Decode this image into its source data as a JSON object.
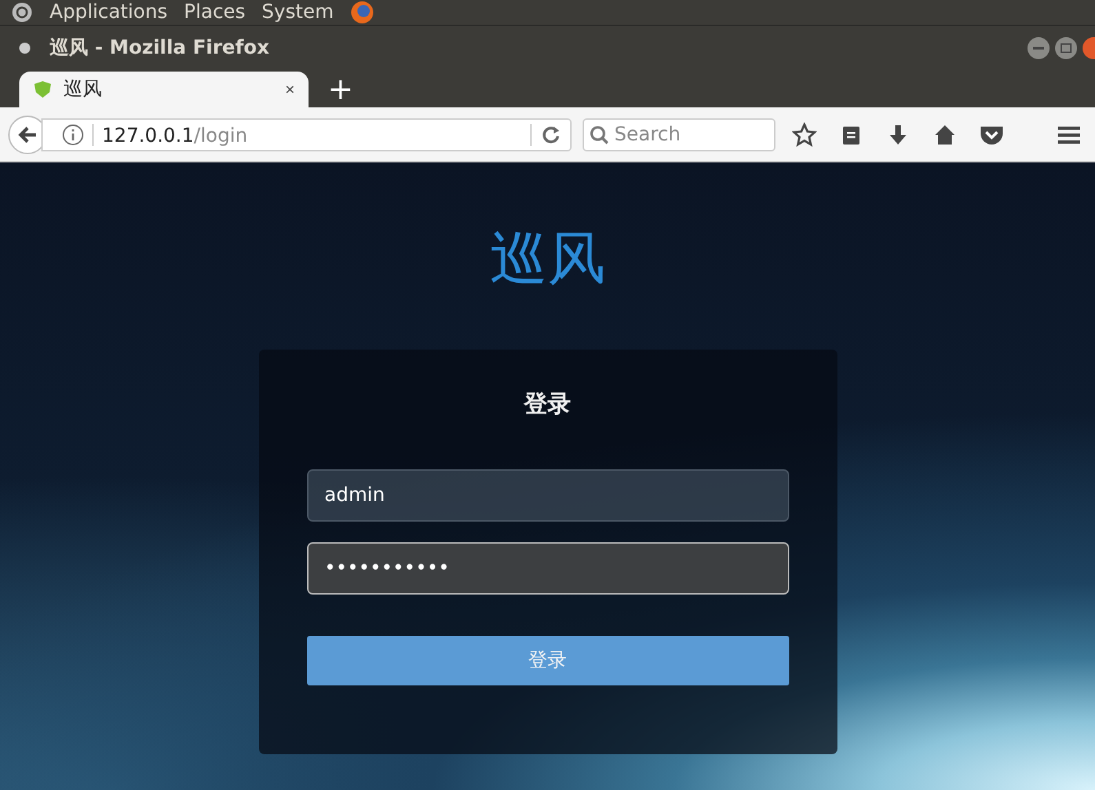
{
  "top_panel": {
    "menus": [
      "Applications",
      "Places",
      "System"
    ]
  },
  "window": {
    "title": "巡风 - Mozilla Firefox"
  },
  "tabs": [
    {
      "label": "巡风",
      "selected": true,
      "close": "×"
    }
  ],
  "new_tab": "+",
  "address_bar": {
    "host": "127.0.0.1",
    "path": "/login"
  },
  "search": {
    "placeholder": "Search"
  },
  "page": {
    "brand": "巡风",
    "login": {
      "heading": "登录",
      "username": "admin",
      "password": "•••••••••••",
      "button": "登录"
    }
  }
}
